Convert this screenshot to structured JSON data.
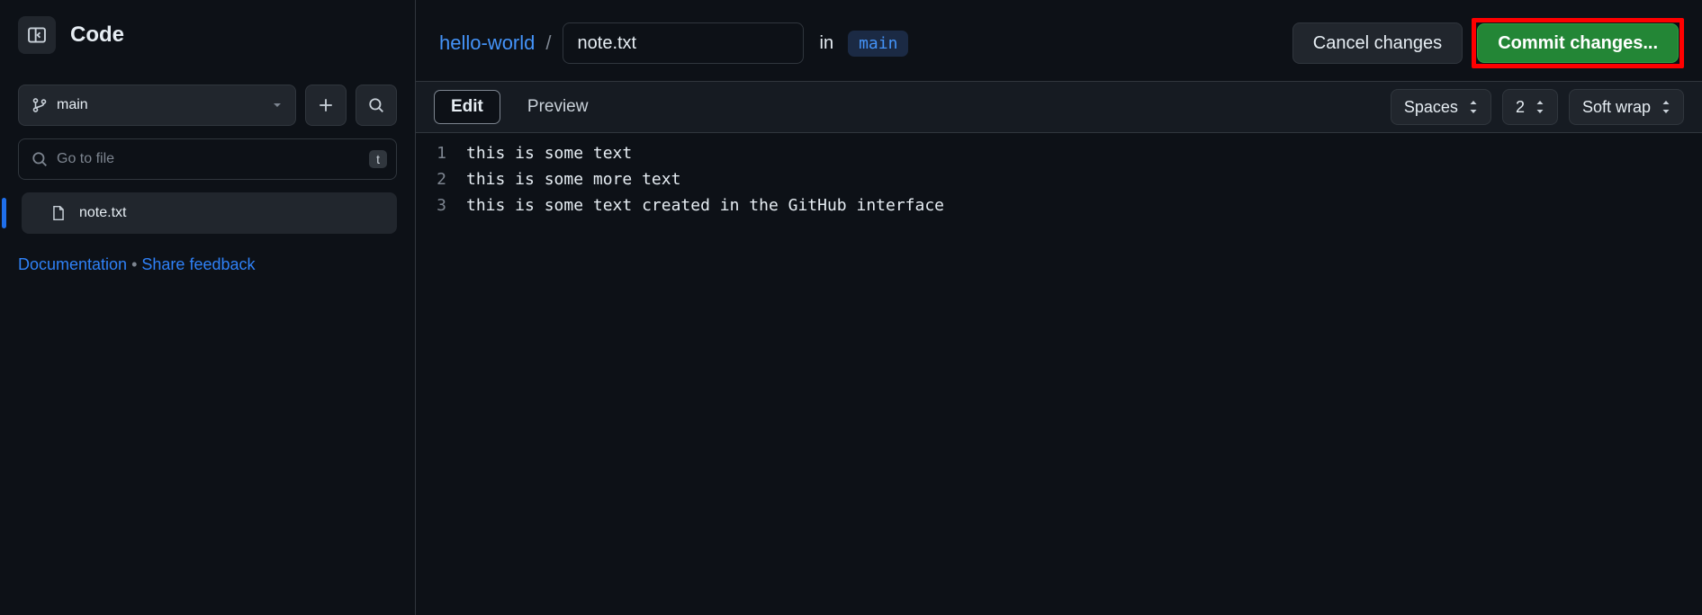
{
  "sidebar": {
    "title": "Code",
    "branch_label": "main",
    "file_search_placeholder": "Go to file",
    "file_search_kbd": "t",
    "file_item": "note.txt",
    "doc_link": "Documentation",
    "feedback_link": "Share feedback"
  },
  "header": {
    "repo": "hello-world",
    "filename": "note.txt",
    "in_label": "in",
    "branch": "main",
    "cancel_label": "Cancel changes",
    "commit_label": "Commit changes..."
  },
  "tabs": {
    "edit": "Edit",
    "preview": "Preview"
  },
  "toolbar": {
    "indent": "Spaces",
    "indent_size": "2",
    "wrap": "Soft wrap"
  },
  "editor": {
    "lines": [
      "this is some text",
      "this is some more text",
      "this is some text created in the GitHub interface"
    ]
  }
}
